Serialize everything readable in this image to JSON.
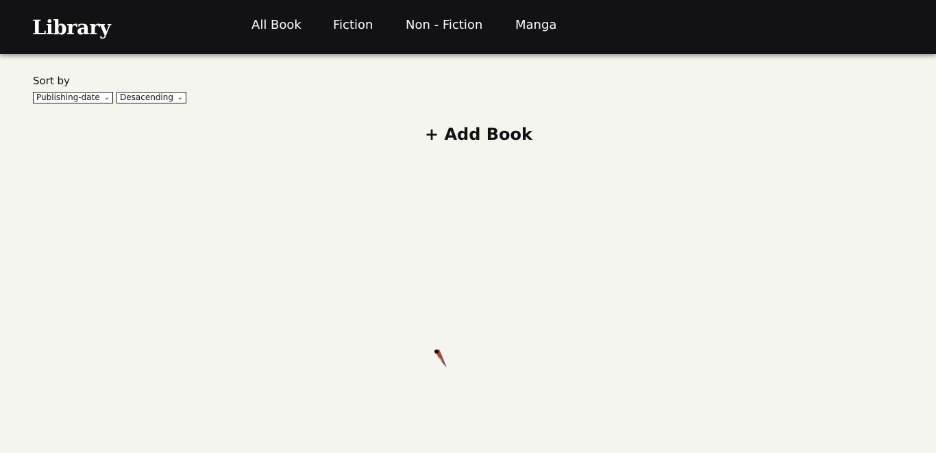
{
  "header": {
    "logo": "Library",
    "nav": [
      {
        "label": "All Book"
      },
      {
        "label": "Fiction"
      },
      {
        "label": "Non - Fiction"
      },
      {
        "label": "Manga"
      }
    ]
  },
  "sort": {
    "label": "Sort by",
    "field_selected": "Publishing-date",
    "order_selected": "Desacending"
  },
  "main": {
    "add_book_label": "+ Add Book"
  },
  "colors": {
    "navbar_bg": "#121214",
    "page_bg": "#f5f5f0"
  },
  "icons": {
    "chevron": "chevron-down-icon",
    "cursor": "feather-cursor-icon"
  }
}
